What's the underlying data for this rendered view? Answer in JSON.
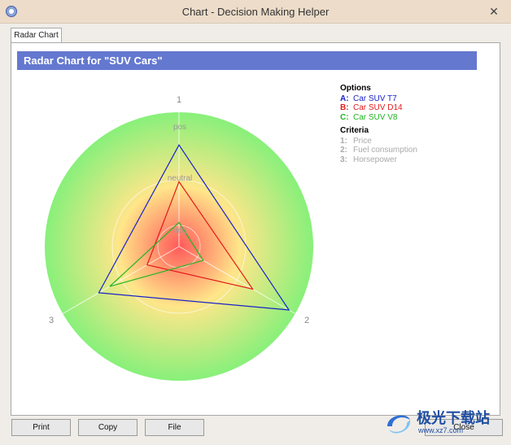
{
  "window": {
    "title": "Chart - Decision Making Helper",
    "close_glyph": "✕"
  },
  "tabs": [
    {
      "label": "Radar Chart"
    }
  ],
  "chart": {
    "header_title": "Radar Chart for  \"SUV Cars\"",
    "ring_labels": [
      "pos",
      "neutral",
      "neg"
    ],
    "colors": {
      "gradient_inner": "#ff5a5a",
      "gradient_mid": "#ffe68a",
      "gradient_outer": "#88f07a",
      "header": "#6478d0"
    }
  },
  "legend": {
    "options_title": "Options",
    "options": [
      {
        "key": "A:",
        "label": "Car SUV T7",
        "color": "#1a23c8"
      },
      {
        "key": "B:",
        "label": "Car SUV D14",
        "color": "#e31a1c"
      },
      {
        "key": "C:",
        "label": "Car SUV V8",
        "color": "#22b422"
      }
    ],
    "criteria_title": "Criteria",
    "criteria": [
      {
        "key": "1:",
        "label": "Price"
      },
      {
        "key": "2:",
        "label": "Fuel consumption"
      },
      {
        "key": "3:",
        "label": "Horsepower"
      }
    ]
  },
  "chart_data": {
    "type": "radar",
    "title": "Radar Chart for  \"SUV Cars\"",
    "axes": [
      "1",
      "2",
      "3"
    ],
    "scale_labels": [
      "neg",
      "neutral",
      "pos"
    ],
    "range": [
      0,
      1
    ],
    "series": [
      {
        "name": "Car SUV T7",
        "values": [
          0.8,
          1.0,
          0.73
        ],
        "color": "#1a23c8"
      },
      {
        "name": "Car SUV D14",
        "values": [
          0.51,
          0.67,
          0.29
        ],
        "color": "#e31a1c"
      },
      {
        "name": "Car SUV V8",
        "values": [
          0.19,
          0.22,
          0.63
        ],
        "color": "#22b422"
      }
    ]
  },
  "buttons": {
    "print": "Print",
    "copy": "Copy",
    "file": "File",
    "close": "Close"
  },
  "watermark": {
    "text": "极光下载站",
    "sub": "www.xz7.com"
  }
}
